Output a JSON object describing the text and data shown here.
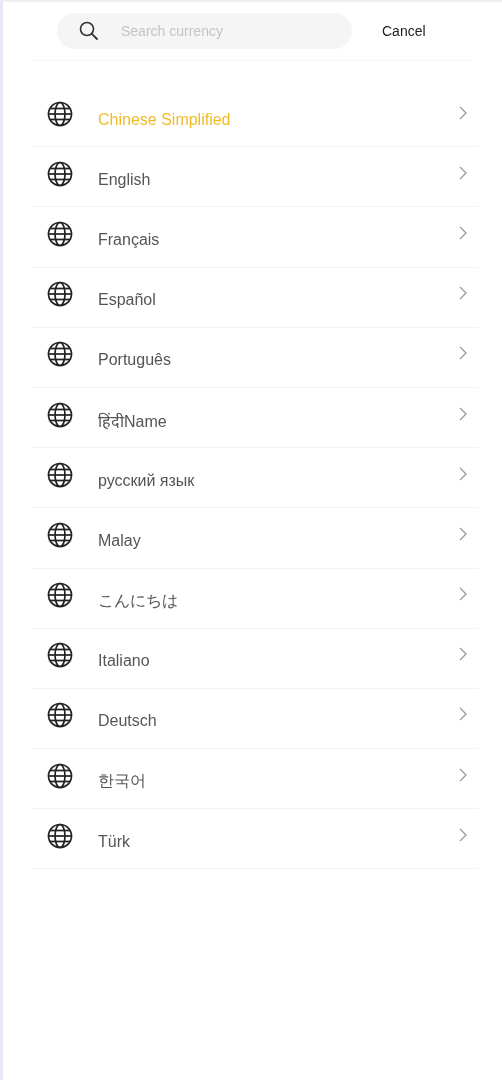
{
  "search": {
    "placeholder": "Search currency"
  },
  "cancel": "Cancel",
  "languages": [
    {
      "label": "Chinese Simplified",
      "selected": true
    },
    {
      "label": "English",
      "selected": false
    },
    {
      "label": "Français",
      "selected": false
    },
    {
      "label": "Español",
      "selected": false
    },
    {
      "label": "Português",
      "selected": false
    },
    {
      "label": "हिंदीName",
      "selected": false
    },
    {
      "label": "русский язык",
      "selected": false
    },
    {
      "label": "Malay",
      "selected": false
    },
    {
      "label": "こんにちは",
      "selected": false
    },
    {
      "label": "Italiano",
      "selected": false
    },
    {
      "label": "Deutsch",
      "selected": false
    },
    {
      "label": "한국어",
      "selected": false
    },
    {
      "label": "Türk",
      "selected": false
    }
  ]
}
